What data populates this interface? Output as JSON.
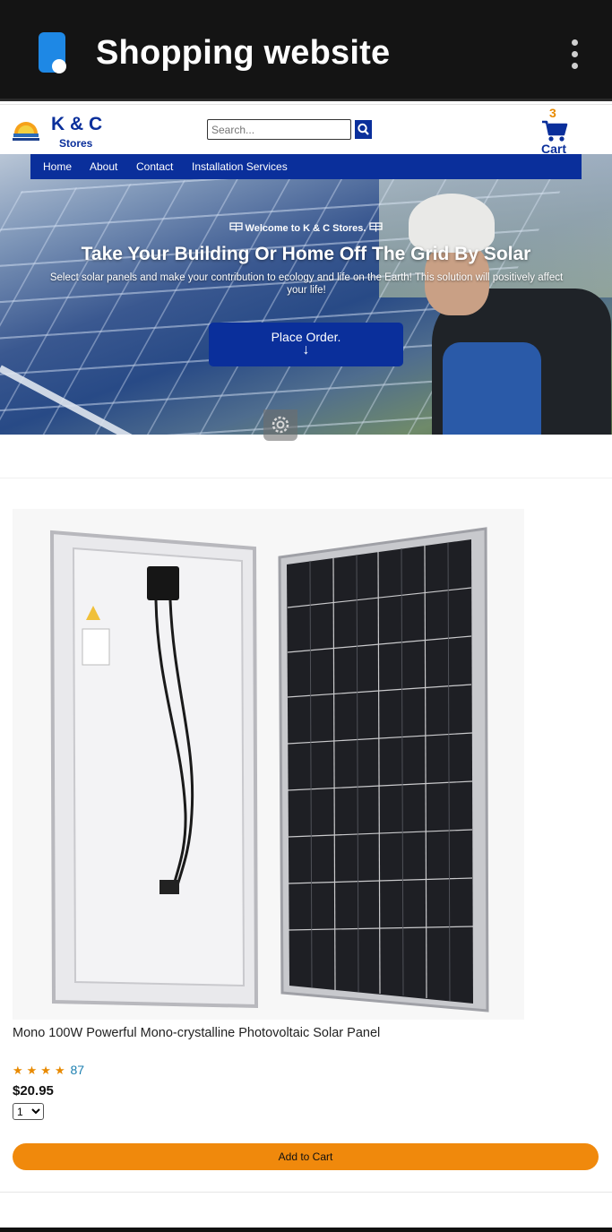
{
  "app_bar": {
    "title": "Shopping website",
    "icons": {
      "app": "app-icon",
      "menu": "more-vertical-icon"
    }
  },
  "header": {
    "brand_name": "K & C",
    "brand_sub": "Stores",
    "search": {
      "placeholder": "Search..."
    },
    "cart": {
      "count": "3",
      "label": "Cart"
    }
  },
  "nav": {
    "items": [
      {
        "label": "Home"
      },
      {
        "label": "About"
      },
      {
        "label": "Contact"
      },
      {
        "label": "Installation Services"
      }
    ]
  },
  "hero": {
    "welcome": "Welcome to K & C Stores.",
    "headline": "Take Your Building Or Home Off The Grid By Solar",
    "subline": "Select solar panels and make your contribution to ecology and life on the Earth! This solution will positively affect your life!",
    "order_button": "Place Order.",
    "order_arrow": "↓"
  },
  "product": {
    "name": "Mono 100W Powerful Mono-crystalline Photovoltaic Solar Panel",
    "stars": "★★★★",
    "rating_count": "87",
    "price": "$20.95",
    "quantity": "1",
    "add_to_cart": "Add to Cart"
  },
  "colors": {
    "brand_blue": "#0a2f9b",
    "accent_orange": "#f0890c",
    "app_bar": "#141414"
  }
}
